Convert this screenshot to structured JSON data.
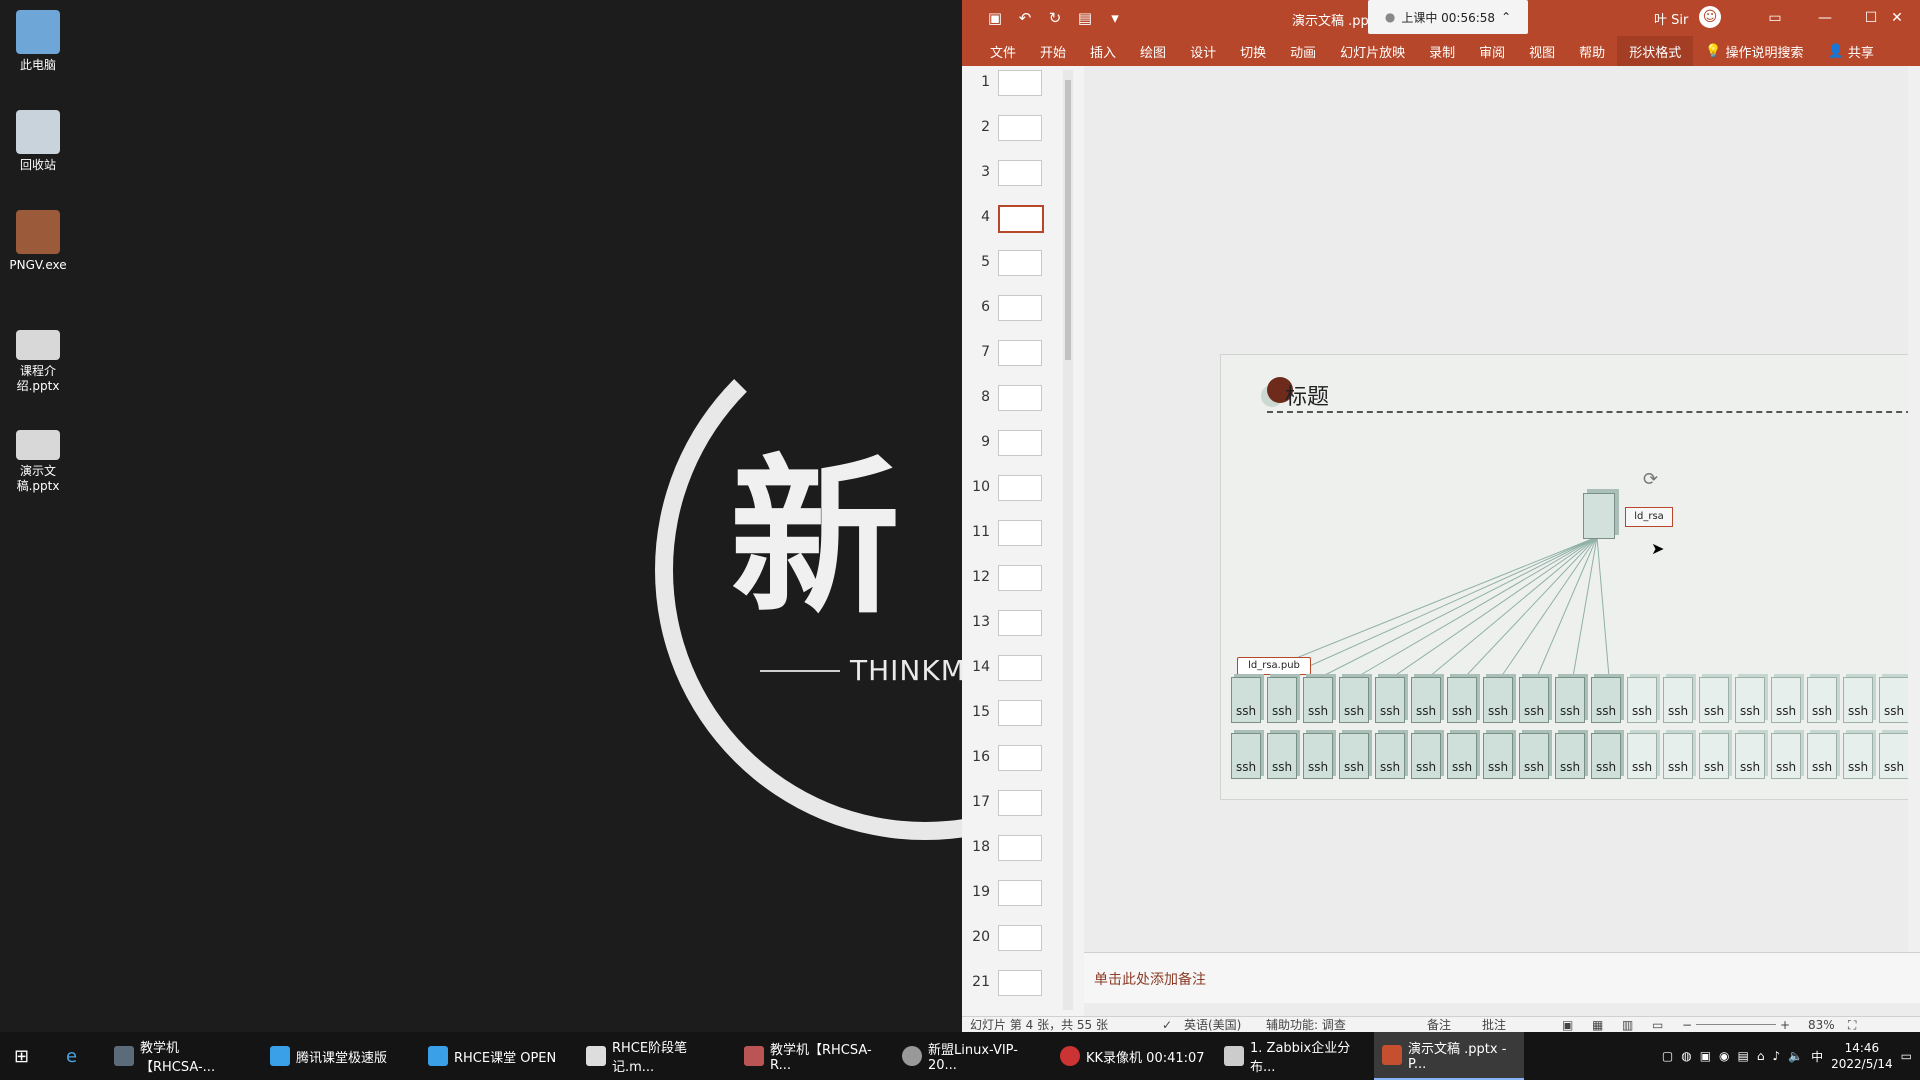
{
  "desktop": {
    "icons": [
      {
        "label": "此电脑",
        "icon": "computer-icon"
      },
      {
        "label": "回收站",
        "icon": "recycle-bin-icon"
      },
      {
        "label": "PNGV.exe",
        "icon": "app-icon"
      },
      {
        "label": "课程介绍.pptx",
        "icon": "pptx-file-icon"
      },
      {
        "label": "演示文稿.pptx",
        "icon": "pptx-file-icon"
      }
    ],
    "wallpaper": {
      "char": "新",
      "subtitle": "THINKMO"
    }
  },
  "ppt": {
    "title": "演示文稿 .pptx",
    "recording": "上课中 00:56:58",
    "user": "叶 Sir",
    "ribbon_tabs": [
      "文件",
      "开始",
      "插入",
      "绘图",
      "设计",
      "切换",
      "动画",
      "幻灯片放映",
      "录制",
      "审阅",
      "视图",
      "帮助",
      "形状格式",
      "操作说明搜索",
      "共享"
    ],
    "active_tab": "形状格式",
    "thumb_numbers": [
      "1",
      "2",
      "3",
      "4",
      "5",
      "6",
      "7",
      "8",
      "9",
      "10",
      "11",
      "12",
      "13",
      "14",
      "15",
      "16",
      "17",
      "18",
      "19",
      "20",
      "21"
    ],
    "selected_slide": 4,
    "slide": {
      "title": "标题",
      "server_label": "ld_rsa",
      "pub_label": "ld_rsa.pub",
      "node_label": "ssh"
    },
    "notes_placeholder": "单击此处添加备注",
    "status": {
      "slide_info": "幻灯片 第 4 张，共 55 张",
      "language": "英语(美国)",
      "accessibility": "辅助功能: 调查",
      "notes": "备注",
      "comments": "批注",
      "zoom": "83%"
    }
  },
  "taskbar": {
    "items": [
      "教学机【RHCSA-...",
      "腾讯课堂极速版",
      "RHCE课堂 OPEN",
      "RHCE阶段笔记.m...",
      "教学机【RHCSA-R...",
      "新盟Linux-VIP-20...",
      "KK录像机 00:41:07",
      "1. Zabbix企业分布...",
      "演示文稿 .pptx - P..."
    ],
    "time": "14:46",
    "date": "2022/5/14",
    "ime": "中"
  }
}
